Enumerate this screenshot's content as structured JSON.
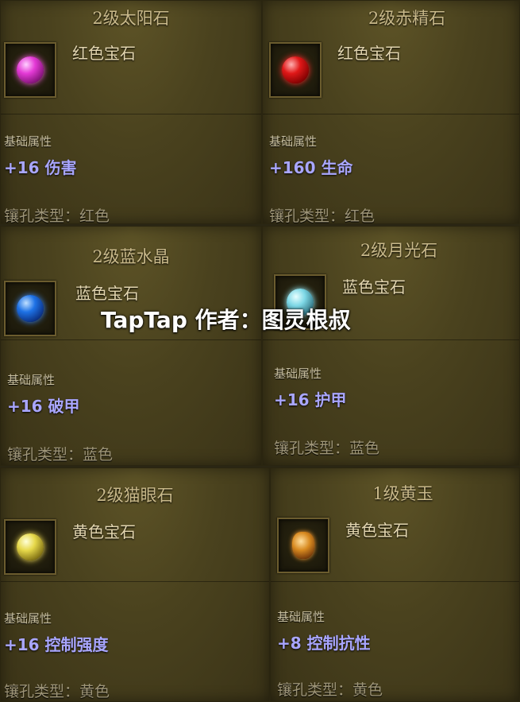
{
  "gems": [
    {
      "title": "2级太阳石",
      "type": "红色宝石",
      "base_label": "基础属性",
      "stat": "+16 伤害",
      "socket": "镶孔类型：红色",
      "icon": "pink-gem-icon"
    },
    {
      "title": "2级赤精石",
      "type": "红色宝石",
      "base_label": "基础属性",
      "stat": "+160 生命",
      "socket": "镶孔类型：红色",
      "icon": "red-gem-icon"
    },
    {
      "title": "2级蓝水晶",
      "type": "蓝色宝石",
      "base_label": "基础属性",
      "stat": "+16 破甲",
      "socket": "镶孔类型：蓝色",
      "icon": "blue-gem-icon"
    },
    {
      "title": "2级月光石",
      "type": "蓝色宝石",
      "base_label": "基础属性",
      "stat": "+16 护甲",
      "socket": "镶孔类型：蓝色",
      "icon": "cyan-gem-icon"
    },
    {
      "title": "2级猫眼石",
      "type": "黄色宝石",
      "base_label": "基础属性",
      "stat": "+16 控制强度",
      "socket": "镶孔类型：黄色",
      "icon": "yellow-gem-icon"
    },
    {
      "title": "1级黄玉",
      "type": "黄色宝石",
      "base_label": "基础属性",
      "stat": "+8 控制抗性",
      "socket": "镶孔类型：黄色",
      "icon": "topaz-gem-icon"
    }
  ],
  "watermark": "TapTap 作者：图灵根叔"
}
